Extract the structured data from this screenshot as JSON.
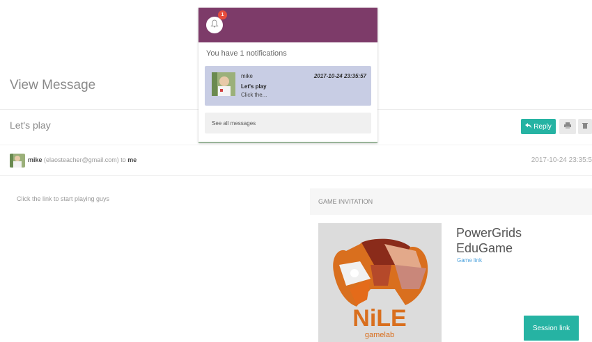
{
  "page": {
    "title": "View Message",
    "subject": "Let's play",
    "reply_label": "Reply",
    "print_icon": "print-icon",
    "trash_icon": "trash-icon"
  },
  "message": {
    "sender_name": "mike",
    "sender_email": "(elaosteacher@gmail.com)",
    "to_text": "to",
    "recipient": "me",
    "date": "2017-10-24 23:35:5",
    "body": "Click the link to start playing guys"
  },
  "invitation": {
    "header": "GAME INVITATION",
    "game_title": "PowerGrids EduGame",
    "game_link_label": "Game link",
    "session_link_label": "Session link",
    "logo_text": "NiLE",
    "logo_subtext": "gamelab"
  },
  "notifications": {
    "badge_count": "1",
    "summary": "You have 1 notifications",
    "items": [
      {
        "name": "mike",
        "date": "2017-10-24 23:35:57",
        "subject": "Let's play",
        "preview": "Click the..."
      }
    ],
    "see_all_label": "See all messages"
  },
  "colors": {
    "accent_teal": "#26b3a3",
    "notif_header": "#7d3b69",
    "notif_item_bg": "#c8cde4",
    "badge_red": "#e74c3c",
    "link_blue": "#4ea3dd"
  }
}
